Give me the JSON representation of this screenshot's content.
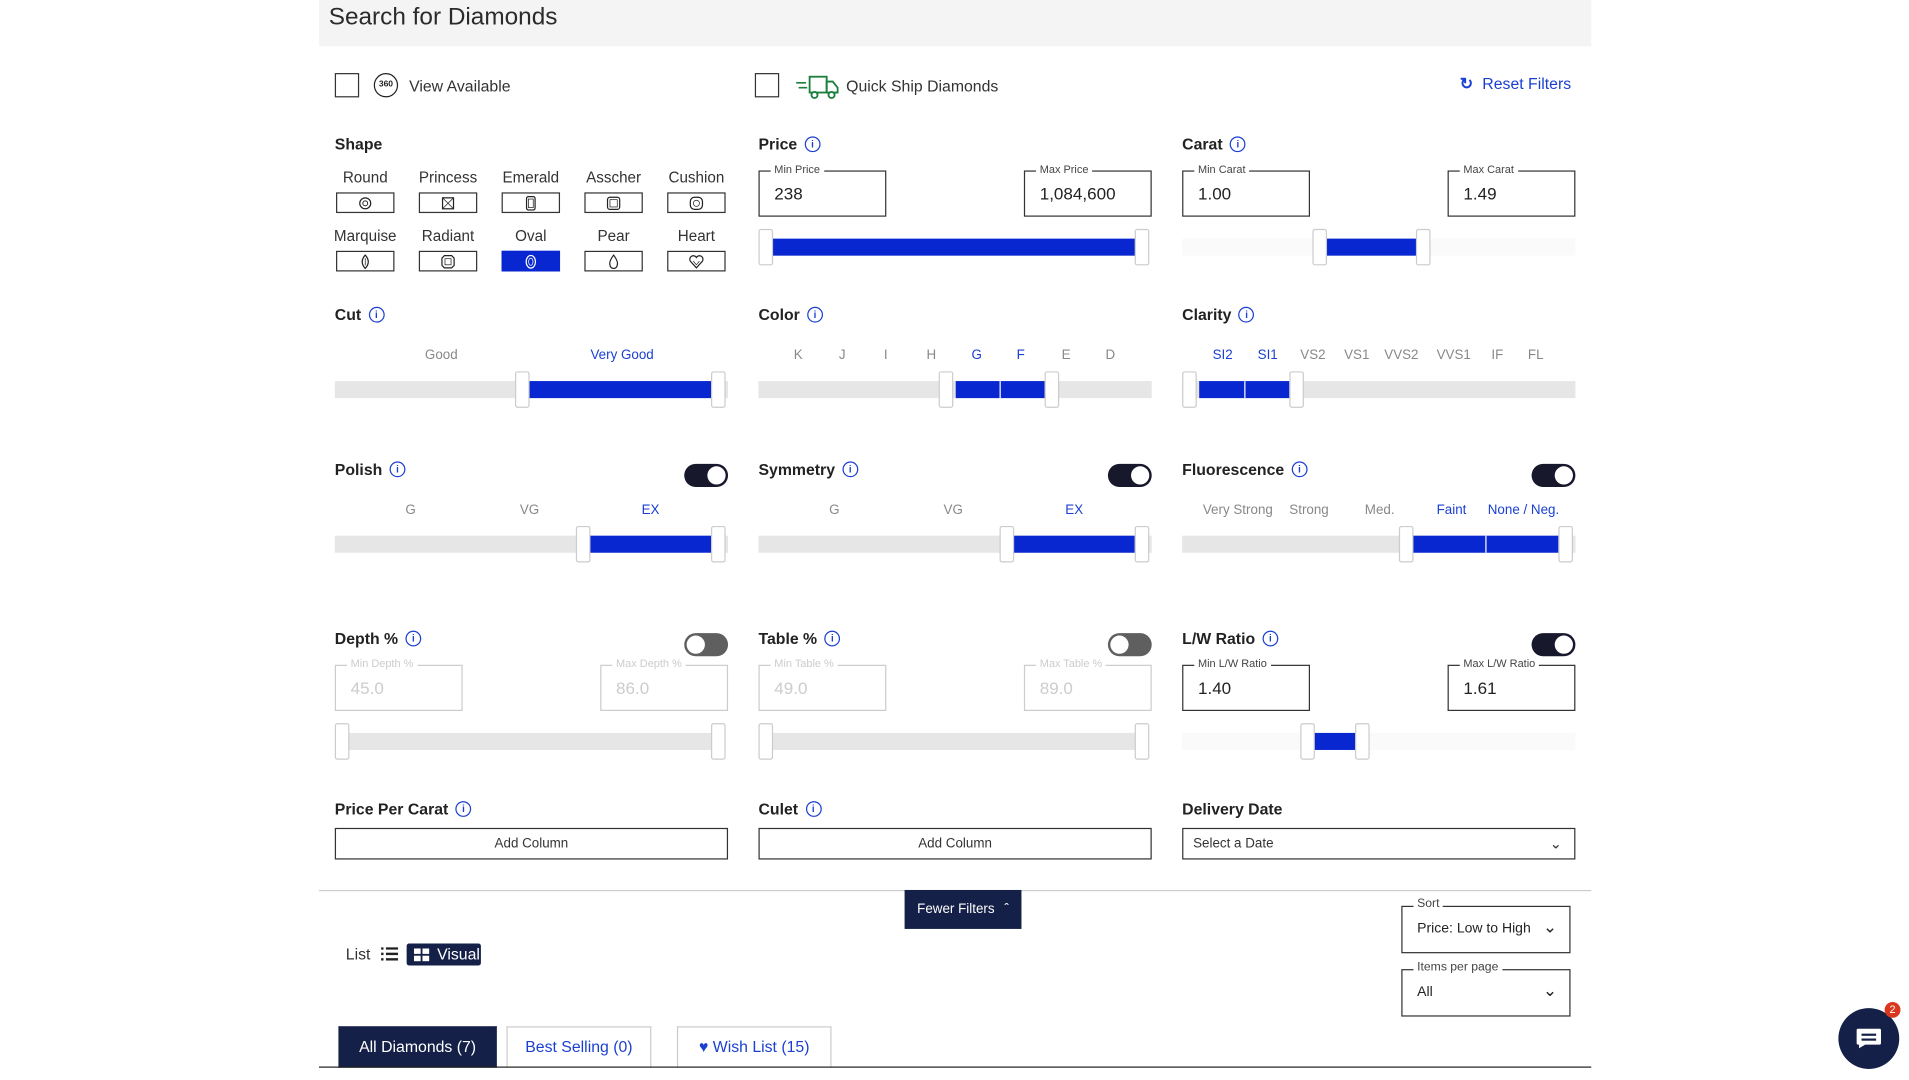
{
  "header": {
    "title": "Search for Diamonds"
  },
  "top": {
    "view_available": "View Available",
    "badge_360": "360",
    "quick_ship": "Quick Ship Diamonds",
    "reset": "Reset Filters"
  },
  "shape": {
    "title": "Shape",
    "items": [
      {
        "label": "Round",
        "icon": "round-cut-icon"
      },
      {
        "label": "Princess",
        "icon": "princess-cut-icon"
      },
      {
        "label": "Emerald",
        "icon": "emerald-cut-icon"
      },
      {
        "label": "Asscher",
        "icon": "asscher-cut-icon"
      },
      {
        "label": "Cushion",
        "icon": "cushion-cut-icon"
      },
      {
        "label": "Marquise",
        "icon": "marquise-cut-icon"
      },
      {
        "label": "Radiant",
        "icon": "radiant-cut-icon"
      },
      {
        "label": "Oval",
        "icon": "oval-cut-icon",
        "selected": true
      },
      {
        "label": "Pear",
        "icon": "pear-cut-icon"
      },
      {
        "label": "Heart",
        "icon": "heart-cut-icon"
      }
    ]
  },
  "price": {
    "title": "Price",
    "min_label": "Min Price",
    "min": "238",
    "max_label": "Max Price",
    "max": "1,084,600"
  },
  "carat": {
    "title": "Carat",
    "min_label": "Min Carat",
    "min": "1.00",
    "max_label": "Max Carat",
    "max": "1.49"
  },
  "cut": {
    "title": "Cut",
    "grades": [
      "Good",
      "Very Good"
    ],
    "selected_from": 1
  },
  "color": {
    "title": "Color",
    "grades": [
      "K",
      "J",
      "I",
      "H",
      "G",
      "F",
      "E",
      "D"
    ],
    "selected": [
      4,
      5
    ]
  },
  "clarity": {
    "title": "Clarity",
    "grades": [
      "SI2",
      "SI1",
      "VS2",
      "VS1",
      "VVS2",
      "VVS1",
      "IF",
      "FL"
    ],
    "selected": [
      0,
      1
    ]
  },
  "polish": {
    "title": "Polish",
    "grades": [
      "G",
      "VG",
      "EX"
    ],
    "selected": [
      2
    ],
    "toggle": true
  },
  "symmetry": {
    "title": "Symmetry",
    "grades": [
      "G",
      "VG",
      "EX"
    ],
    "selected": [
      2
    ],
    "toggle": true
  },
  "fluorescence": {
    "title": "Fluorescence",
    "grades": [
      "Very Strong",
      "Strong",
      "Med.",
      "Faint",
      "None / Neg."
    ],
    "selected": [
      3,
      4
    ],
    "toggle": true
  },
  "depth": {
    "title": "Depth %",
    "min_label": "Min Depth %",
    "min": "45.0",
    "max_label": "Max Depth %",
    "max": "86.0",
    "toggle": false
  },
  "table": {
    "title": "Table %",
    "min_label": "Min Table %",
    "min": "49.0",
    "max_label": "Max Table %",
    "max": "89.0",
    "toggle": false
  },
  "lw": {
    "title": "L/W Ratio",
    "min_label": "Min L/W Ratio",
    "min": "1.40",
    "max_label": "Max L/W Ratio",
    "max": "1.61",
    "toggle": true
  },
  "ppc": {
    "title": "Price Per Carat",
    "button": "Add Column"
  },
  "culet": {
    "title": "Culet",
    "button": "Add Column"
  },
  "delivery": {
    "title": "Delivery Date",
    "placeholder": "Select a Date"
  },
  "fewer": "Fewer Filters",
  "view": {
    "list": "List",
    "visual": "Visual"
  },
  "sort": {
    "label": "Sort",
    "value": "Price: Low to High"
  },
  "per_page": {
    "label": "Items per page",
    "value": "All"
  },
  "tabs": [
    {
      "label": "All Diamonds (7)",
      "active": true
    },
    {
      "label": "Best Selling (0)"
    },
    {
      "label": "Wish List (15)"
    }
  ],
  "chat": {
    "badge": "2"
  },
  "colors": {
    "accent": "#0827d0",
    "link": "#1a3fd1",
    "dark": "#142047"
  }
}
